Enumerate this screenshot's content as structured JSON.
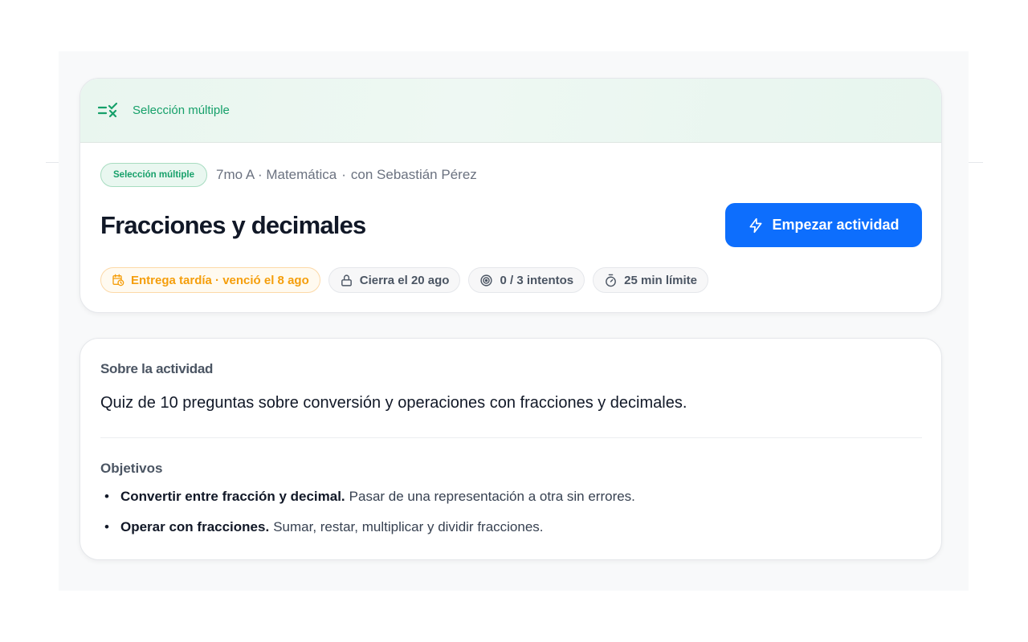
{
  "banner": {
    "label": "Selección múltiple",
    "icon": "multiple-choice-icon"
  },
  "meta": {
    "type_badge": "Selección múltiple",
    "course": "7mo A · Matemática",
    "separator": "·",
    "teacher": "con Sebastián Pérez"
  },
  "activity": {
    "title": "Fracciones y decimales",
    "start_button": "Empezar actividad"
  },
  "chips": {
    "late": "Entrega tardía · venció el 8 ago",
    "closes": "Cierra el 20 ago",
    "attempts": "0 / 3 intentos",
    "time_limit": "25 min límite"
  },
  "about": {
    "heading": "Sobre la actividad",
    "description": "Quiz de 10 preguntas sobre conversión y operaciones con fracciones y decimales.",
    "objectives_heading": "Objetivos",
    "objectives": [
      {
        "title": "Convertir entre fracción y decimal.",
        "text": "Pasar de una representación a otra sin errores."
      },
      {
        "title": "Operar con fracciones.",
        "text": "Sumar, restar, multiplicar y dividir fracciones."
      }
    ]
  },
  "colors": {
    "accent": "#0d6efd",
    "success": "#16a06a",
    "warning": "#f59e0b"
  }
}
